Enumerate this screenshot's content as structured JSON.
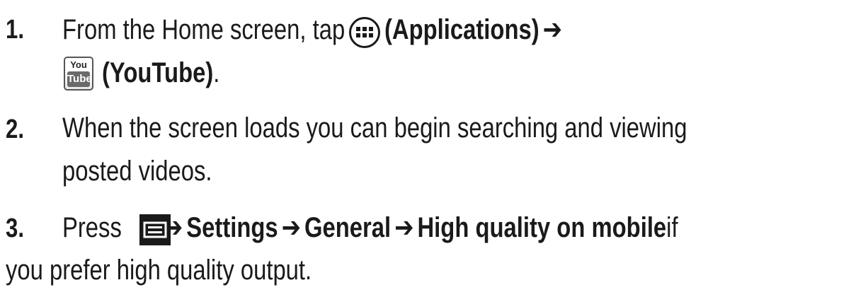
{
  "steps": [
    {
      "number": "1.",
      "line1_a": "From the Home screen, tap",
      "line1_b_bold": "(Applications)",
      "line1_arrow": "➔",
      "line2_bold": "(YouTube)",
      "line2_tail": ".",
      "icons": [
        "apps-grid-icon",
        "youtube-icon"
      ]
    },
    {
      "number": "2.",
      "line1": "When the screen loads you can begin searching and viewing",
      "line2": "posted videos."
    },
    {
      "number": "3.",
      "line1_a": "Press",
      "arrow": "➔",
      "settings": "Settings",
      "general": "General",
      "high_quality": "High quality on mobile",
      "line1_tail": " if",
      "line2": "you prefer high quality output.",
      "icons": [
        "menu-icon"
      ]
    }
  ]
}
